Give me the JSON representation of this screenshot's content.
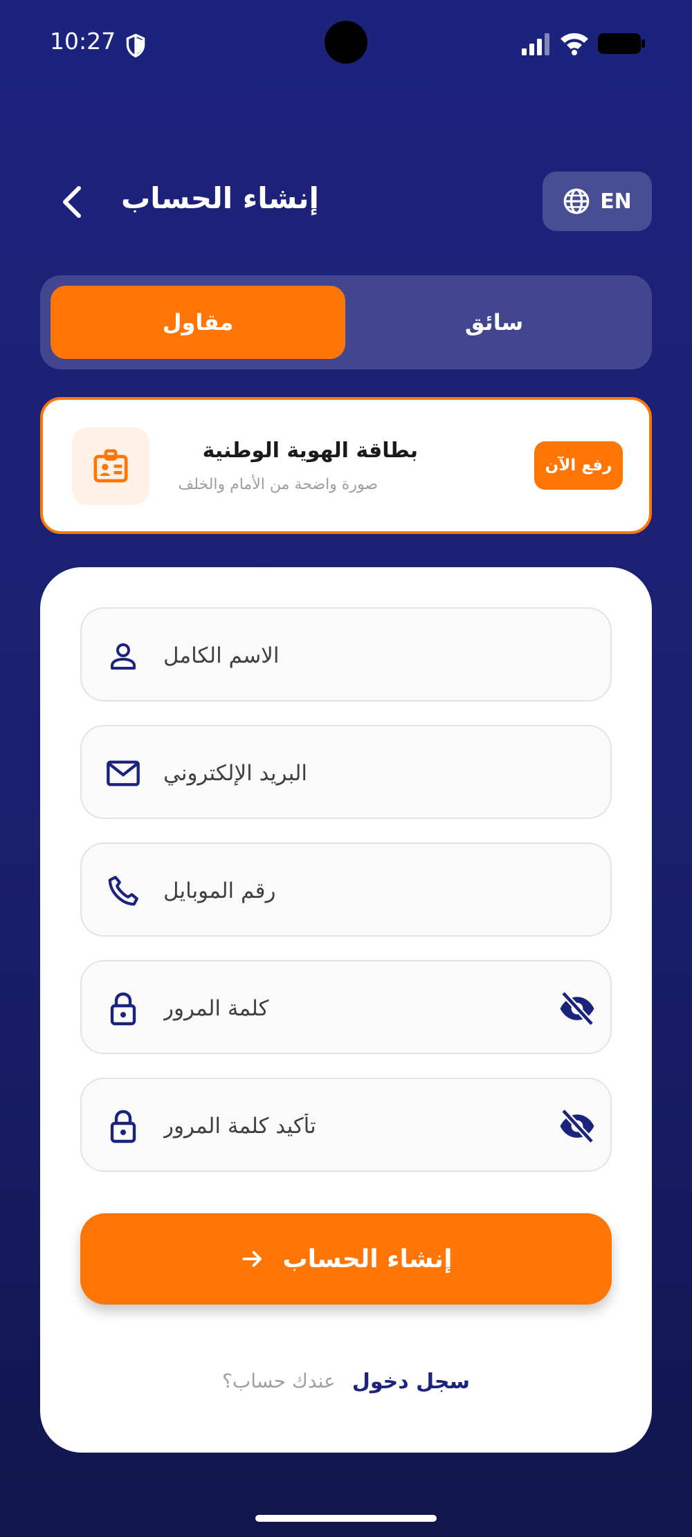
{
  "status_bar": {
    "time": "10:27"
  },
  "header": {
    "title": "إنشاء الحساب",
    "language_label": "EN"
  },
  "role_toggle": {
    "options": [
      {
        "label": "مقاول",
        "selected": true
      },
      {
        "label": "سائق",
        "selected": false
      }
    ]
  },
  "id_card": {
    "title": "بطاقة الهوية الوطنية",
    "subtitle": "صورة واضحة من الأمام والخلف",
    "upload_label": "رفع الآن"
  },
  "form": {
    "fields": [
      {
        "placeholder": "الاسم الكامل",
        "value": "",
        "icon": "person-icon"
      },
      {
        "placeholder": "البريد الإلكتروني",
        "value": "",
        "icon": "mail-icon"
      },
      {
        "placeholder": "رقم الموبايل",
        "value": "",
        "icon": "phone-icon"
      },
      {
        "placeholder": "كلمة المرور",
        "value": "",
        "icon": "lock-icon"
      },
      {
        "placeholder": "تأكيد كلمة المرور",
        "value": "",
        "icon": "lock-icon"
      }
    ],
    "submit_label": "إنشاء الحساب",
    "login_link": "سجل دخول",
    "login_question": "عندك حساب؟"
  },
  "colors": {
    "accent": "#ff7506",
    "brand": "#1c237d",
    "background": "#1a1f6e"
  }
}
